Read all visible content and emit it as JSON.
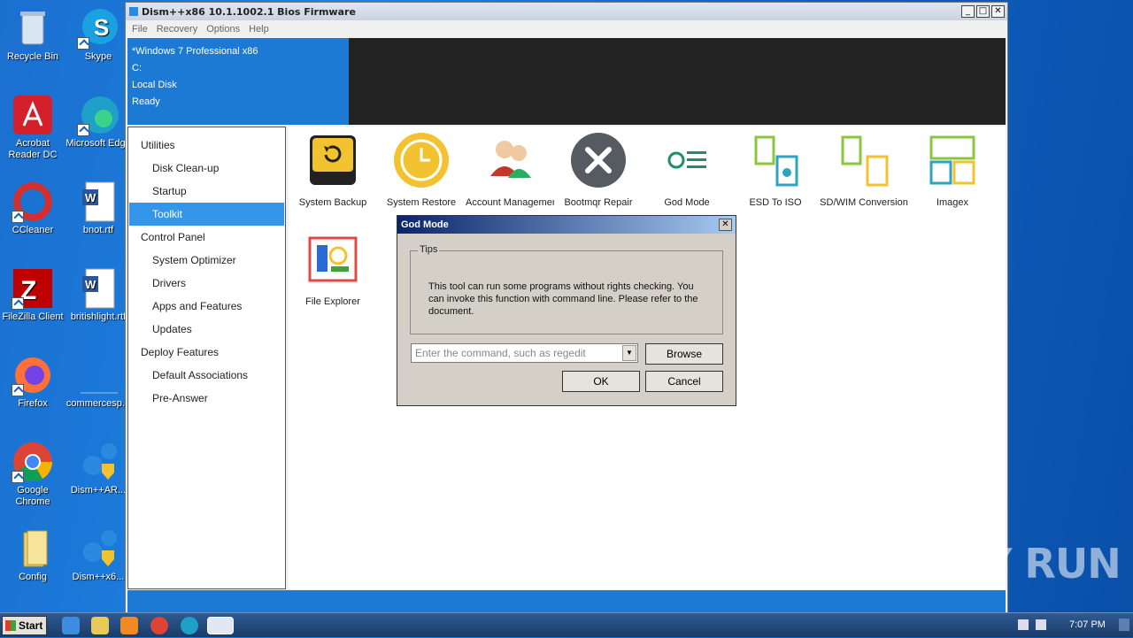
{
  "desktop": {
    "icons": [
      {
        "label": "Recycle Bin"
      },
      {
        "label": "Skype"
      },
      {
        "label": "Acrobat Reader DC"
      },
      {
        "label": "Microsoft Edge"
      },
      {
        "label": "CCleaner"
      },
      {
        "label": "bnot.rtf"
      },
      {
        "label": "FileZilla Client"
      },
      {
        "label": "britishlight.rtf"
      },
      {
        "label": "Firefox"
      },
      {
        "label": "commercesp..."
      },
      {
        "label": "Google Chrome"
      },
      {
        "label": "Dism++AR..."
      },
      {
        "label": "Config"
      },
      {
        "label": "Dism++x6..."
      }
    ]
  },
  "window": {
    "title": "Dism++x86 10.1.1002.1 Bios Firmware",
    "menu": [
      "File",
      "Recovery",
      "Options",
      "Help"
    ],
    "controls": {
      "minimize": "_",
      "maximize": "□",
      "close": "✕"
    },
    "info": [
      "*Windows 7 Professional x86",
      "C:",
      "Local Disk",
      "Ready"
    ]
  },
  "sidebar": {
    "items": [
      {
        "label": "Utilities"
      },
      {
        "label": "Disk Clean-up"
      },
      {
        "label": "Startup"
      },
      {
        "label": "Toolkit"
      },
      {
        "label": "Control Panel"
      },
      {
        "label": "System Optimizer"
      },
      {
        "label": "Drivers"
      },
      {
        "label": "Apps and Features"
      },
      {
        "label": "Updates"
      },
      {
        "label": "Deploy Features"
      },
      {
        "label": "Default Associations"
      },
      {
        "label": "Pre-Answer"
      }
    ]
  },
  "tools": [
    {
      "label": "System Backup"
    },
    {
      "label": "System Restore"
    },
    {
      "label": "Account Management"
    },
    {
      "label": "Bootmqr Repair"
    },
    {
      "label": "God Mode"
    },
    {
      "label": "ESD To ISO"
    },
    {
      "label": "SD/WIM Conversion"
    },
    {
      "label": "Imagex"
    },
    {
      "label": "File Explorer"
    }
  ],
  "dialog": {
    "title": "God Mode",
    "close": "✕",
    "group_label": "Tips",
    "tip": "This tool can run some programs without rights checking. You can invoke this function with command line. Please refer to the document.",
    "placeholder": "Enter the command, such as regedit",
    "browse": "Browse",
    "ok": "OK",
    "cancel": "Cancel"
  },
  "taskbar": {
    "start": "Start",
    "time": "7:07 PM"
  },
  "watermark": "ANY RUN"
}
